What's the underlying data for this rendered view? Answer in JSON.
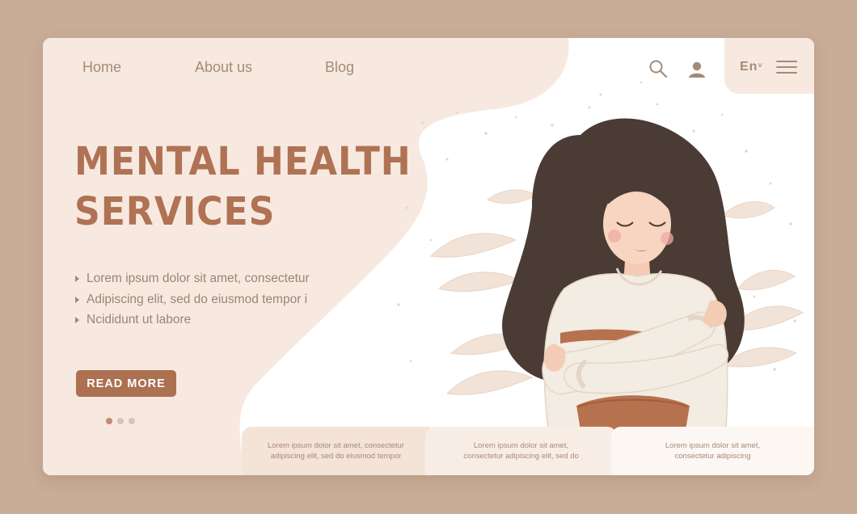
{
  "nav": {
    "home": "Home",
    "about": "About us",
    "blog": "Blog",
    "language": "En",
    "language_caret": "˅",
    "icons": [
      "search-icon",
      "user-icon",
      "menu-icon"
    ]
  },
  "hero": {
    "title_line1": "MENTAL HEALTH",
    "title_line2": "SERVICES",
    "bullets": [
      "Lorem ipsum dolor sit amet, consectetur",
      "Adipiscing elit, sed do eiusmod tempor i",
      "Ncididunt ut labore"
    ],
    "cta": "READ MORE",
    "slide_count": 3,
    "active_slide": 1
  },
  "panels": [
    {
      "line1": "Lorem ipsum dolor sit amet, consectetur",
      "line2": "adipiscing elit, sed do eiusmod tempor"
    },
    {
      "line1": "Lorem ipsum dolor sit amet,",
      "line2": "consectetur adipiscing elit, sed do"
    },
    {
      "line1": "Lorem ipsum dolor sit amet,",
      "line2": "consectetur adipiscing"
    }
  ],
  "colors": {
    "page_background": "#c8ad98",
    "accent_brown": "#ab7151",
    "title_brown": "#b07254",
    "cream": "#f7e9df",
    "text_muted": "#9c8474"
  }
}
